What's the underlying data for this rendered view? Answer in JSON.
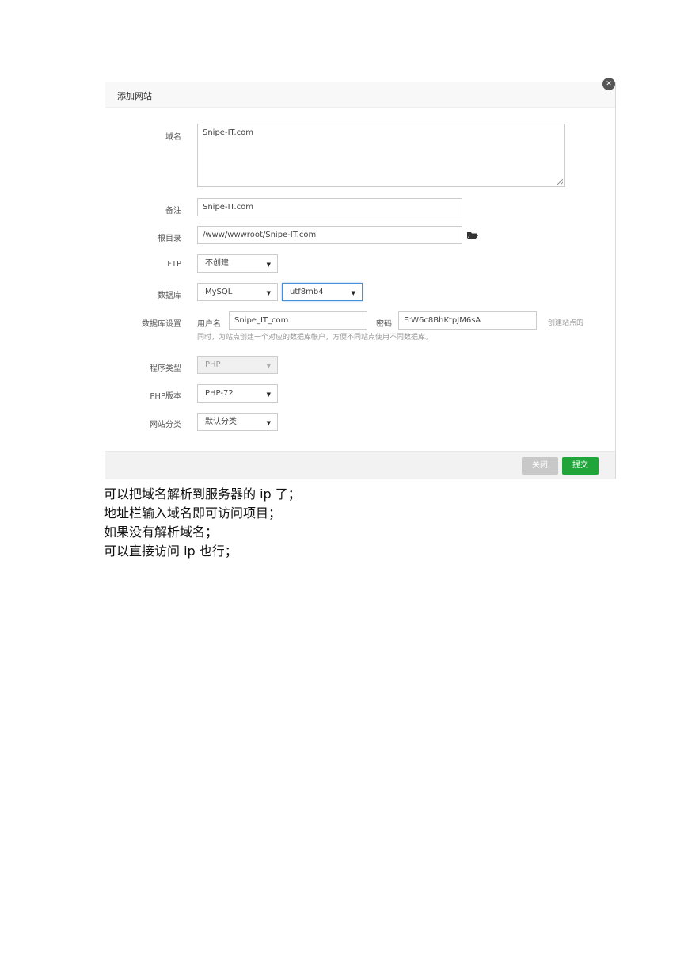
{
  "dialog": {
    "title": "添加网站",
    "close_icon": "close-icon",
    "fields": {
      "domain": {
        "label": "域名",
        "value": "Snipe-IT.com"
      },
      "remark": {
        "label": "备注",
        "value": "Snipe-IT.com"
      },
      "root_dir": {
        "label": "根目录",
        "value": "/www/wwwroot/Snipe-IT.com",
        "icon": "folder-open-icon"
      },
      "ftp": {
        "label": "FTP",
        "value": "不创建"
      },
      "database": {
        "label": "数据库",
        "type_value": "MySQL",
        "charset_value": "utf8mb4"
      },
      "db_settings": {
        "label": "数据库设置",
        "user_label": "用户名",
        "user_value": "Snipe_IT_com",
        "password_label": "密码",
        "password_value": "FrW6c8BhKtpJM6sA",
        "hint_line1": "创建站点的",
        "hint_line2": "同时，为站点创建一个对应的数据库帐户，方便不同站点使用不同数据库。"
      },
      "program_type": {
        "label": "程序类型",
        "value": "PHP"
      },
      "php_version": {
        "label": "PHP版本",
        "value": "PHP-72"
      },
      "site_category": {
        "label": "网站分类",
        "value": "默认分类"
      }
    },
    "buttons": {
      "close": "关闭",
      "submit": "提交"
    },
    "colors": {
      "submit": "#20a53a",
      "close": "#c8c8c8",
      "focus": "#4a90d9"
    }
  },
  "notes": [
    "可以把域名解析到服务器的 ip 了；",
    "地址栏输入域名即可访问项目；",
    "如果没有解析域名；",
    "可以直接访问 ip 也行；"
  ]
}
